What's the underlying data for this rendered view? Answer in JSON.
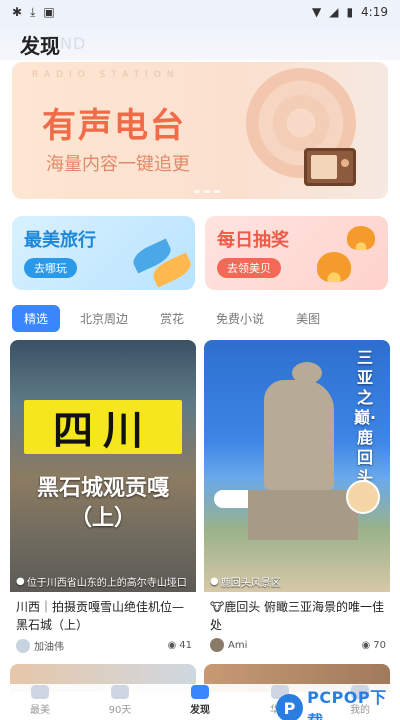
{
  "status_bar": {
    "icons_left": [
      "usb-icon",
      "download-icon",
      "gallery-icon"
    ],
    "icons_right": [
      "wifi-icon",
      "signal-icon",
      "battery-icon"
    ],
    "time": "4:19"
  },
  "header": {
    "title": "发现",
    "ghost_text": "ND"
  },
  "banner": {
    "watermark": "RADIO STATION",
    "title": "有声电台",
    "subtitle": "海量内容一键追更"
  },
  "cards": {
    "travel": {
      "title": "最美旅行",
      "button": "去哪玩"
    },
    "lottery": {
      "title": "每日抽奖",
      "button": "去领美贝"
    }
  },
  "tabs": [
    "精选",
    "北京周边",
    "赏花",
    "免费小说",
    "美图"
  ],
  "feed": [
    {
      "overlay_main": "四川",
      "overlay_line1": "黑石城观贡嘎",
      "overlay_line2": "（上）",
      "location": "位于川西省山东的上的高尔寺山垭口",
      "caption": "川西｜拍摄贡嘎雪山绝佳机位—黑石城（上）",
      "author": "加油伟",
      "views": "41"
    },
    {
      "vertical_title": "三亚之巅·鹿回头",
      "location": "鹿回头风景区",
      "caption": "🐮鹿回头 俯瞰三亚海景的唯一佳处",
      "author": "Ami",
      "views": "70"
    }
  ],
  "bottom_nav": [
    {
      "label": "最美",
      "icon": "home-icon"
    },
    {
      "label": "90天",
      "icon": "calendar-icon"
    },
    {
      "label": "发现",
      "icon": "discover-icon"
    },
    {
      "label": "华晨",
      "icon": "star-icon"
    },
    {
      "label": "我的",
      "icon": "user-icon"
    }
  ],
  "watermark": {
    "logo": "P",
    "text": "PCPOP下载"
  },
  "colors": {
    "accent": "#3a86ff",
    "banner_title": "#f06b47"
  }
}
